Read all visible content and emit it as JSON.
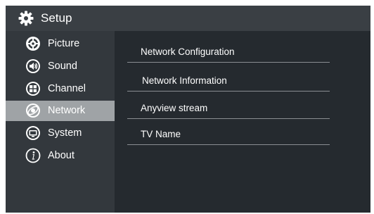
{
  "header": {
    "title": "Setup",
    "icon": "gear-icon"
  },
  "sidebar": {
    "items": [
      {
        "label": "Picture",
        "icon": "picture-settings-icon",
        "active": false
      },
      {
        "label": "Sound",
        "icon": "speaker-icon",
        "active": false
      },
      {
        "label": "Channel",
        "icon": "channel-grid-icon",
        "active": false
      },
      {
        "label": "Network",
        "icon": "globe-icon",
        "active": true
      },
      {
        "label": "System",
        "icon": "monitor-icon",
        "active": false
      },
      {
        "label": "About",
        "icon": "info-icon",
        "active": false
      }
    ]
  },
  "content": {
    "options": [
      {
        "label": "Network Configuration"
      },
      {
        "label": "Network Information"
      },
      {
        "label": "Anyview stream"
      },
      {
        "label": "TV Name"
      }
    ]
  },
  "colors": {
    "background": "#252a2f",
    "titlebar": "#3a3f44",
    "sidebar": "#33383d",
    "active_item": "#9fa3a6",
    "divider": "#8a8e92"
  }
}
